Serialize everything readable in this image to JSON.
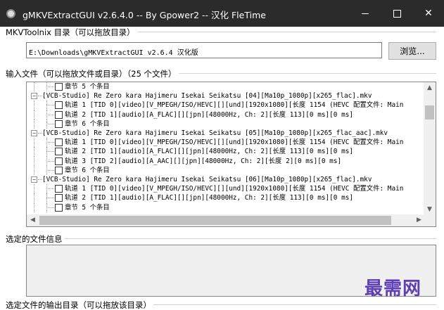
{
  "window": {
    "title": "gMKVExtractGUI v2.6.4.0 -- By Gpower2 -- 汉化 FleTime",
    "controls": {
      "minimize": "—",
      "maximize": "☐",
      "close": "✕"
    }
  },
  "mkvtoolnix": {
    "group_label": "MKVToolnix 目录（可以拖放目录）",
    "path_value": "E:\\Downloads\\gMKVExtractGUI v2.6.4 汉化版",
    "browse_label": "浏览..."
  },
  "input_files": {
    "group_label": "输入文件（可以拖放文件或目录）（25 个文件）",
    "tree": [
      {
        "level": 1,
        "kind": "chapter",
        "text": "章节 5 个条目"
      },
      {
        "level": 0,
        "kind": "file",
        "text": "[VCB-Studio] Re Zero kara Hajimeru Isekai Seikatsu [04][Ma10p_1080p][x265_flac].mkv"
      },
      {
        "level": 1,
        "kind": "track",
        "text": "轨道 1 [TID 0][video][V_MPEGH/ISO/HEVC][][und][1920x1080][长度 1154 (HEVC 配置文件: Main"
      },
      {
        "level": 1,
        "kind": "track",
        "text": "轨道 2 [TID 1][audio][A_FLAC][][jpn][48000Hz, Ch: 2][长度 113][0 ms][0 ms]"
      },
      {
        "level": 1,
        "kind": "chapter",
        "text": "章节 6 个条目"
      },
      {
        "level": 0,
        "kind": "file",
        "text": "[VCB-Studio] Re Zero kara Hajimeru Isekai Seikatsu [05][Ma10p_1080p][x265_flac_aac].mkv"
      },
      {
        "level": 1,
        "kind": "track",
        "text": "轨道 1 [TID 0][video][V_MPEGH/ISO/HEVC][][und][1920x1080][长度 1154 (HEVC 配置文件: Main"
      },
      {
        "level": 1,
        "kind": "track",
        "text": "轨道 2 [TID 1][audio][A_FLAC][][jpn][48000Hz, Ch: 2][长度 113][0 ms][0 ms]"
      },
      {
        "level": 1,
        "kind": "track",
        "text": "轨道 3 [TID 2][audio][A_AAC][][jpn][48000Hz, Ch: 2][长度 2][0 ms][0 ms]"
      },
      {
        "level": 1,
        "kind": "chapter",
        "text": "章节 6 个条目"
      },
      {
        "level": 0,
        "kind": "file",
        "text": "[VCB-Studio] Re Zero kara Hajimeru Isekai Seikatsu [06][Ma10p_1080p][x265_flac].mkv"
      },
      {
        "level": 1,
        "kind": "track",
        "text": "轨道 1 [TID 0][video][V_MPEGH/ISO/HEVC][][und][1920x1080][长度 1154 (HEVC 配置文件: Main"
      },
      {
        "level": 1,
        "kind": "track",
        "text": "轨道 2 [TID 1][audio][A_FLAC][][jpn][48000Hz, Ch: 2][长度 113][0 ms][0 ms]"
      },
      {
        "level": 1,
        "kind": "chapter",
        "text": "章节 5 个条目"
      }
    ],
    "expander_symbol": "−",
    "scroll_arrows": {
      "up": "▲",
      "down": "▼",
      "left": "◀",
      "right": "▶"
    }
  },
  "selected_file_info": {
    "group_label": "选定的文件信息"
  },
  "output_dir": {
    "group_label": "选定文件的输出目录（可以拖放该目录）"
  },
  "watermark": "最需网",
  "colors": {
    "titlebar": "#2b2b2b",
    "watermark": "#5e3fb5",
    "scroll_thumb": "#c1c1c1"
  }
}
